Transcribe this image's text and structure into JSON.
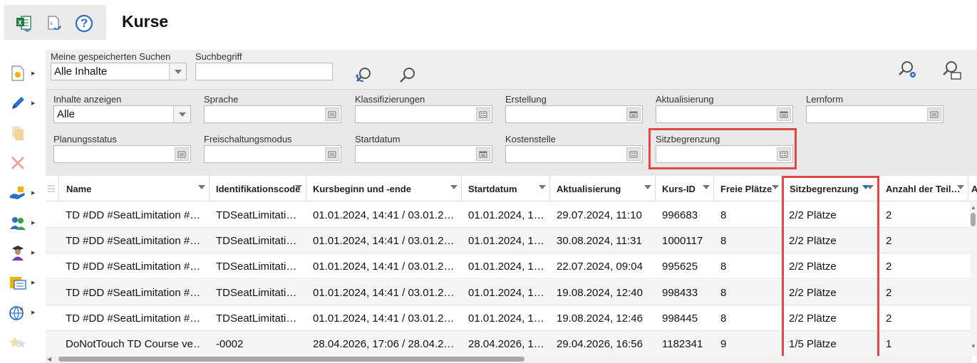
{
  "page": {
    "title": "Kurse"
  },
  "colors": {
    "accent": "#2a6fc9",
    "highlight": "#e04848",
    "excel": "#1d7a43"
  },
  "toolbar": {
    "icons": [
      "excel-export-icon",
      "export-icon",
      "help-icon"
    ],
    "help_glyph": "?"
  },
  "sidebar": {
    "items": [
      "new-item-icon",
      "edit-icon",
      "copy-icon",
      "delete-icon",
      "assign-icon",
      "users-icon",
      "trainer-icon",
      "catalog-icon",
      "translate-icon",
      "favorite-icon"
    ]
  },
  "search": {
    "saved_label": "Meine gespeicherten Suchen",
    "saved_value": "Alle Inhalte",
    "term_label": "Suchbegriff",
    "term_value": ""
  },
  "filters": {
    "inhalte_label": "Inhalte anzeigen",
    "inhalte_value": "Alle",
    "sprache_label": "Sprache",
    "klassifizierungen_label": "Klassifizierungen",
    "erstellung_label": "Erstellung",
    "aktualisierung_label": "Aktualisierung",
    "lernform_label": "Lernform",
    "planungsstatus_label": "Planungsstatus",
    "freischaltungsmodus_label": "Freischaltungsmodus",
    "startdatum_label": "Startdatum",
    "kostenstelle_label": "Kostenstelle",
    "sitzbegrenzung_label": "Sitzbegrenzung"
  },
  "table": {
    "columns": [
      "Name",
      "Identifikationscode",
      "Kursbeginn und -ende",
      "Startdatum",
      "Aktualisierung",
      "Kurs-ID",
      "Freie Plätze",
      "Sitzbegrenzung",
      "Anzahl der Teil…",
      "A"
    ],
    "rows": [
      [
        "TD #DD #SeatLimitation #…",
        "TDSeatLimitati…",
        "01.01.2024, 14:41 / 03.01.2…",
        "01.01.2024, 1…",
        "29.07.2024, 11:10",
        "996683",
        "8",
        "2/2 Plätze",
        "2"
      ],
      [
        "TD #DD #SeatLimitation #…",
        "TDSeatLimitati…",
        "01.01.2024, 14:41 / 03.01.2…",
        "01.01.2024, 1…",
        "30.08.2024, 11:31",
        "1000117",
        "8",
        "2/2 Plätze",
        "2"
      ],
      [
        "TD #DD #SeatLimitation #…",
        "TDSeatLimitati…",
        "01.01.2024, 14:41 / 03.01.2…",
        "01.01.2024, 1…",
        "22.07.2024, 09:04",
        "995625",
        "8",
        "2/2 Plätze",
        "2"
      ],
      [
        "TD #DD #SeatLimitation #…",
        "TDSeatLimitati…",
        "01.01.2024, 14:41 / 03.01.2…",
        "01.01.2024, 1…",
        "19.08.2024, 12:40",
        "998433",
        "8",
        "2/2 Plätze",
        "2"
      ],
      [
        "TD #DD #SeatLimitation #…",
        "TDSeatLimitati…",
        "01.01.2024, 14:41 / 03.01.2…",
        "01.01.2024, 1…",
        "19.08.2024, 12:46",
        "998445",
        "8",
        "2/2 Plätze",
        "2"
      ],
      [
        "DoNotTouch TD Course ve…",
        "-0002",
        "28.04.2026, 17:06 / 28.04.2…",
        "28.04.2026, 1…",
        "29.04.2026, 16:56",
        "1182341",
        "9",
        "1/5 Plätze",
        "1"
      ]
    ]
  }
}
